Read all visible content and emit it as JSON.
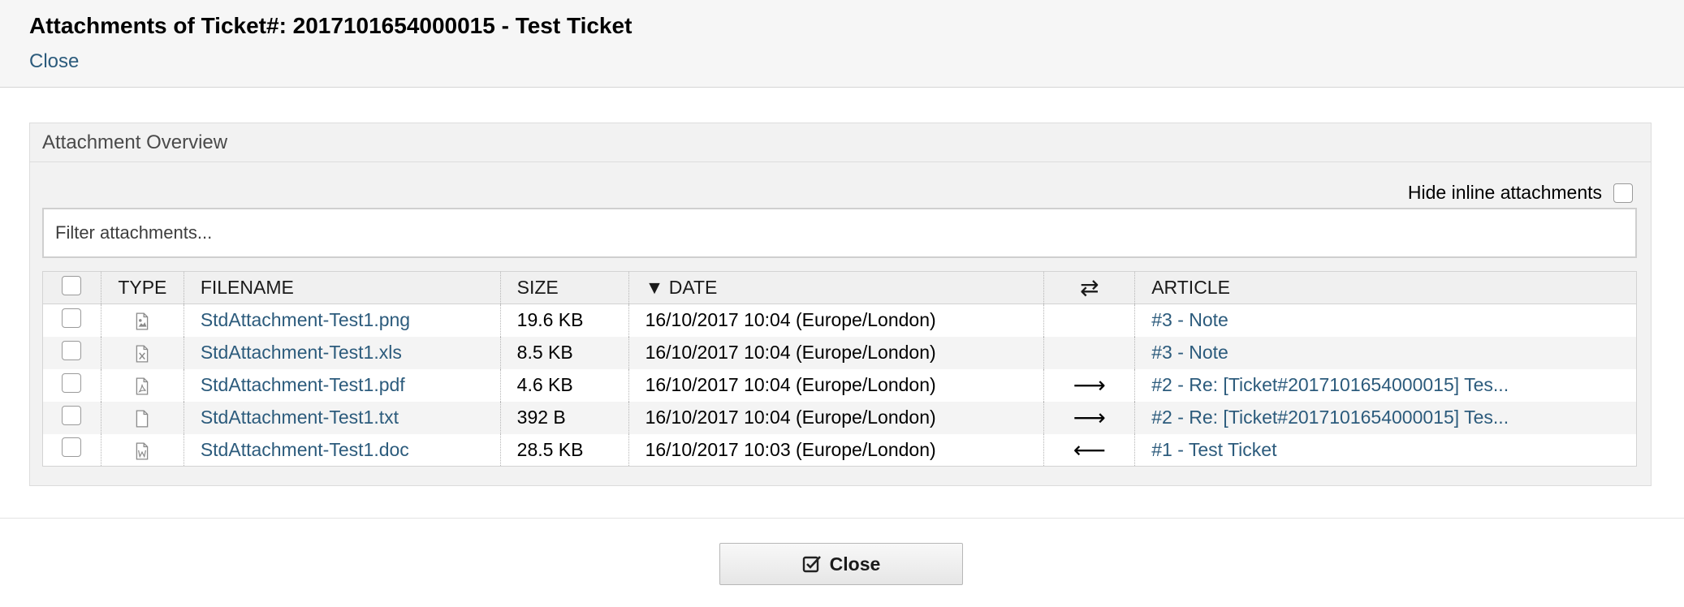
{
  "header": {
    "title": "Attachments of Ticket#: 2017101654000015 - Test Ticket",
    "close_label": "Close"
  },
  "widget": {
    "title": "Attachment Overview",
    "hide_inline_label": "Hide inline attachments",
    "hide_inline_checked": false,
    "filter_placeholder": "Filter attachments..."
  },
  "table": {
    "columns": {
      "type": "TYPE",
      "filename": "FILENAME",
      "size": "SIZE",
      "date": "▼ DATE",
      "direction": "⇄",
      "article": "ARTICLE"
    },
    "rows": [
      {
        "icon": "image-file-icon",
        "filename": "StdAttachment-Test1.png",
        "size": "19.6 KB",
        "date": "16/10/2017 10:04 (Europe/London)",
        "direction": "",
        "article": "#3 - Note"
      },
      {
        "icon": "excel-file-icon",
        "filename": "StdAttachment-Test1.xls",
        "size": "8.5 KB",
        "date": "16/10/2017 10:04 (Europe/London)",
        "direction": "",
        "article": "#3 - Note"
      },
      {
        "icon": "pdf-file-icon",
        "filename": "StdAttachment-Test1.pdf",
        "size": "4.6 KB",
        "date": "16/10/2017 10:04 (Europe/London)",
        "direction": "⟶",
        "article": "#2 - Re: [Ticket#2017101654000015] Tes..."
      },
      {
        "icon": "text-file-icon",
        "filename": "StdAttachment-Test1.txt",
        "size": "392 B",
        "date": "16/10/2017 10:04 (Europe/London)",
        "direction": "⟶",
        "article": "#2 - Re: [Ticket#2017101654000015] Tes..."
      },
      {
        "icon": "word-file-icon",
        "filename": "StdAttachment-Test1.doc",
        "size": "28.5 KB",
        "date": "16/10/2017 10:03 (Europe/London)",
        "direction": "⟵",
        "article": "#1 - Test Ticket"
      }
    ]
  },
  "footer": {
    "close_label": "Close",
    "close_icon": "checkbox-check-icon"
  },
  "colors": {
    "link": "#2c5b7c",
    "header_bg": "#f6f6f6",
    "widget_bg": "#f2f2f2"
  }
}
